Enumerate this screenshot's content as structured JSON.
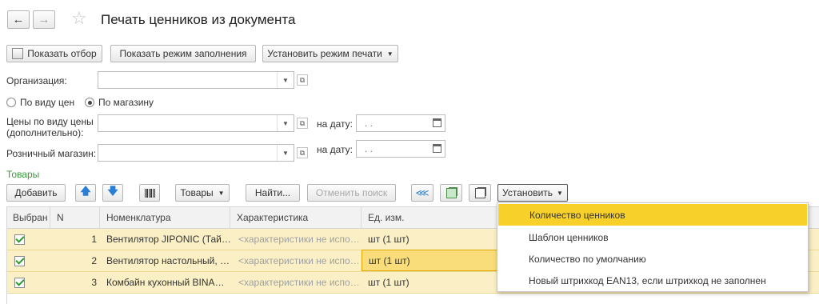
{
  "header": {
    "title": "Печать ценников из документа"
  },
  "toolbar": {
    "show_filter": "Показать отбор",
    "show_fill_mode": "Показать режим заполнения",
    "set_print_mode": "Установить режим печати"
  },
  "form": {
    "organization_label": "Организация:",
    "radio_by_price_type": "По виду цен",
    "radio_by_store": "По магазину",
    "radio_selected": "По магазину",
    "prices_label_1": "Цены по виду цены",
    "prices_label_2": "(дополнительно):",
    "store_label": "Розничный магазин:",
    "date_label": "на дату:",
    "date_value": " .  .",
    "organization_value": "",
    "prices_value": "",
    "store_value": ""
  },
  "goods": {
    "section_title": "Товары",
    "add": "Добавить",
    "goods_menu": "Товары",
    "find": "Найти...",
    "cancel_search": "Отменить поиск",
    "set": "Установить",
    "columns": [
      "Выбран",
      "N",
      "Номенклатура",
      "Характеристика",
      "Ед. изм."
    ],
    "rows": [
      {
        "checked": true,
        "n": "1",
        "item": "Вентилятор JIPONIC (Тай…",
        "characteristic": "<характеристики не испо…",
        "unit": "шт (1 шт)"
      },
      {
        "checked": true,
        "n": "2",
        "item": "Вентилятор настольный, …",
        "characteristic": "<характеристики не испо…",
        "unit": "шт (1 шт)"
      },
      {
        "checked": true,
        "n": "3",
        "item": "Комбайн кухонный BINA…",
        "characteristic": "<характеристики не испо…",
        "unit": "шт (1 шт)"
      }
    ]
  },
  "dropdown_menu": {
    "items": [
      "Количество ценников",
      "Шаблон ценников",
      "Количество по умолчанию",
      "Новый штрихкод EAN13, если штрихкод не заполнен"
    ],
    "selected_index": 0
  },
  "colors": {
    "accent": "#f7d02a",
    "row_bg": "#fbf0c5",
    "section_title": "#3a9a3a",
    "icon_blue": "#2a7fd4"
  }
}
